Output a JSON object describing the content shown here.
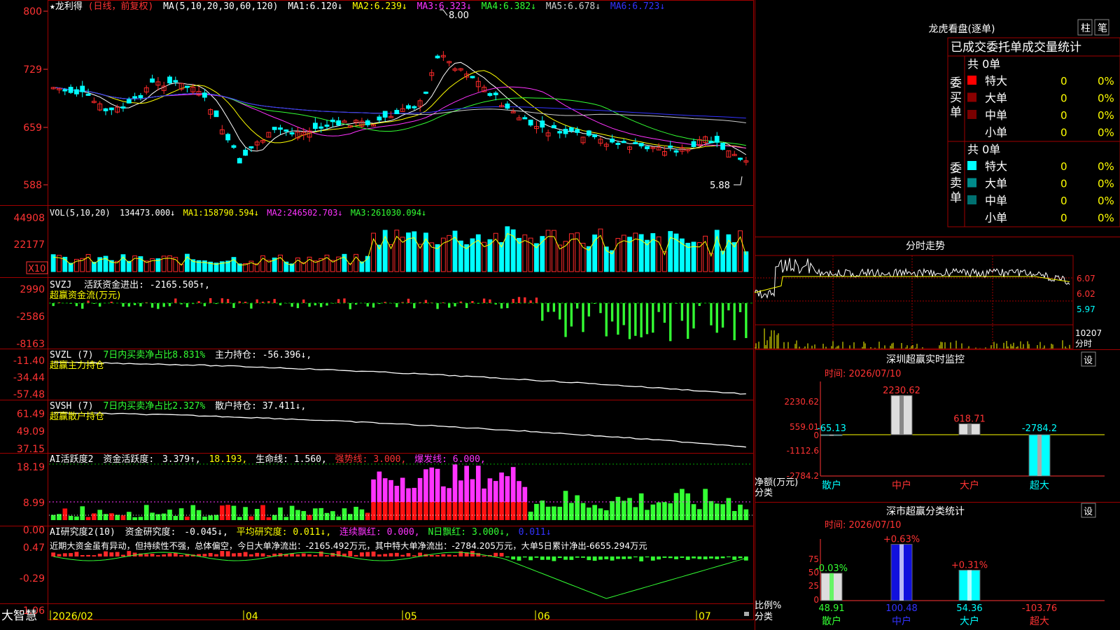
{
  "colors": {
    "up": "#ff2a2a",
    "down": "#00ffff",
    "ma1": "#ffffff",
    "ma2": "#ffff00",
    "ma3": "#ff33ff",
    "ma4": "#33ff33",
    "ma5": "#cccccc",
    "ma6": "#3333ff",
    "axis_label": "#ff3333",
    "grid": "#8b0000"
  },
  "app": {
    "brand": "大智慧",
    "stock_title": "★龙利得",
    "stock_note": "(日线，前复权)"
  },
  "price_panel": {
    "ma_prefix": "MA(5,10,20,30,60,120)",
    "ma_values": [
      {
        "name": "MA1:",
        "value": "6.120↓",
        "color": "#ffffff"
      },
      {
        "name": "MA2:",
        "value": "6.239↓",
        "color": "#ffff00"
      },
      {
        "name": "MA3:",
        "value": "6.323↓",
        "color": "#ff33ff"
      },
      {
        "name": "MA4:",
        "value": "6.382↓",
        "color": "#33ff33"
      },
      {
        "name": "MA5:",
        "value": "6.678↓",
        "color": "#cccccc"
      },
      {
        "name": "MA6:",
        "value": "6.723↓",
        "color": "#3333ff"
      }
    ],
    "y_ticks": [
      "800",
      "729",
      "659",
      "588"
    ],
    "high_label": "8.00",
    "low_label": "5.88"
  },
  "vol_panel": {
    "title": "VOL(5,10,20)",
    "value": "134473.000↓",
    "ma_values": [
      {
        "name": "MA1:",
        "value": "158790.594↓",
        "color": "#ffff00"
      },
      {
        "name": "MA2:",
        "value": "246502.703↓",
        "color": "#ff33ff"
      },
      {
        "name": "MA3:",
        "value": "261030.094↓",
        "color": "#33ff33"
      }
    ],
    "y_ticks": [
      "44908",
      "22177"
    ],
    "unit": "X10"
  },
  "svzj_panel": {
    "title": "SVZJ",
    "label": "活跃资金进出:",
    "value": "-2165.505↑,",
    "sub": "超赢资金流(万元)",
    "y_ticks": [
      "2990",
      "-2586",
      "-8163"
    ]
  },
  "svzl_panel": {
    "title": "SVZL (7)",
    "ratio": "7日内买卖净占比8.831%",
    "label": "主力持仓:",
    "value": "-56.396↓,",
    "sub": "超赢主力持仓",
    "y_ticks": [
      "-11.40",
      "-34.44",
      "-57.48"
    ]
  },
  "svsh_panel": {
    "title": "SVSH (7)",
    "ratio": "7日内买卖净占比2.327%",
    "label": "散户持仓:",
    "value": "37.411↓,",
    "sub": "超赢散户持仓",
    "y_ticks": [
      "61.49",
      "49.09",
      "37.15"
    ]
  },
  "ai_active_panel": {
    "title": "AI活跃度2",
    "label": "资金活跃度:",
    "value1": "3.379↑,",
    "value2": "18.193,",
    "life_line": "生命线: 1.560,",
    "strong_line": "强势线: 3.000,",
    "burst_line": "爆发线: 6.000,",
    "y_ticks": [
      "18.19",
      "8.99",
      "0.00"
    ]
  },
  "ai_research_panel": {
    "title": "AI研究度2(10)",
    "label": "资金研究度:",
    "value": "-0.045↓,",
    "avg": "平均研究度: 0.011↓,",
    "red": "连续飘红: 0.000,",
    "nred": "N日飘红: 3.000↓,",
    "last": "0.011↓",
    "comment": "近期大资金虽有异动，但持续性不强，总体偏空，今日大单净流出：-2165.492万元，其中特大单净流出：-2784.205万元，大单5日累计净出-6655.294万元",
    "y_ticks": [
      "0.47",
      "-0.29",
      "-1.06"
    ]
  },
  "x_axis": {
    "labels": [
      "2026/02",
      "04",
      "05",
      "06",
      "07"
    ]
  },
  "dragon_panel": {
    "title": "龙虎看盘(逐单)",
    "btn_column": "柱",
    "btn_pen": "笔",
    "header": "已成交委托单成交量统计",
    "buy": {
      "side_label": "委买单",
      "total": "共 0单",
      "rows": [
        {
          "name": "特大",
          "count": "0",
          "pct": "0%",
          "swatch": "#ff0000"
        },
        {
          "name": "大单",
          "count": "0",
          "pct": "0%",
          "swatch": "#8b0000"
        },
        {
          "name": "中单",
          "count": "0",
          "pct": "0%",
          "swatch": "#7a0000"
        },
        {
          "name": "小单",
          "count": "0",
          "pct": "0%",
          "swatch": ""
        }
      ]
    },
    "sell": {
      "side_label": "委卖单",
      "total": "共 0单",
      "rows": [
        {
          "name": "特大",
          "count": "0",
          "pct": "0%",
          "swatch": "#00ffff"
        },
        {
          "name": "大单",
          "count": "0",
          "pct": "0%",
          "swatch": "#008b8b"
        },
        {
          "name": "中单",
          "count": "0",
          "pct": "0%",
          "swatch": "#007070"
        },
        {
          "name": "小单",
          "count": "0",
          "pct": "0%",
          "swatch": ""
        }
      ]
    }
  },
  "intraday_panel": {
    "title": "分时走势",
    "price_ticks": [
      "6.07",
      "6.02",
      "5.97"
    ],
    "vol_tick": "10207",
    "vol_unit": "分时"
  },
  "sz_monitor": {
    "title": "深圳超赢实时监控",
    "btn": "设",
    "time": "时间: 2026/07/10",
    "y_ticks": [
      "2230.62",
      "559.01",
      "0",
      "-1112.6",
      "-2784.2"
    ],
    "y_label1": "净额(万元)",
    "y_label2": "分类",
    "categories": [
      "散户",
      "中户",
      "大户",
      "超大"
    ],
    "values": [
      -65.13,
      2230.62,
      618.71,
      -2784.2
    ],
    "value_labels": [
      "-65.13",
      "2230.62",
      "618.71",
      "-2784.2"
    ]
  },
  "sz_class": {
    "title": "深市超赢分类统计",
    "btn": "设",
    "time": "时间: 2026/07/10",
    "y_ticks": [
      "75",
      "50",
      "25",
      "0"
    ],
    "y_label1": "比例%",
    "y_label2": "分类",
    "categories": [
      "散户",
      "中户",
      "大户",
      "超大"
    ],
    "pct_labels": [
      "-0.03%",
      "+0.63%",
      "+0.31%"
    ],
    "bottom_values": [
      "48.91",
      "100.48",
      "54.36",
      "-103.76"
    ],
    "bar_values": [
      48.91,
      100.48,
      54.36,
      0
    ]
  }
}
